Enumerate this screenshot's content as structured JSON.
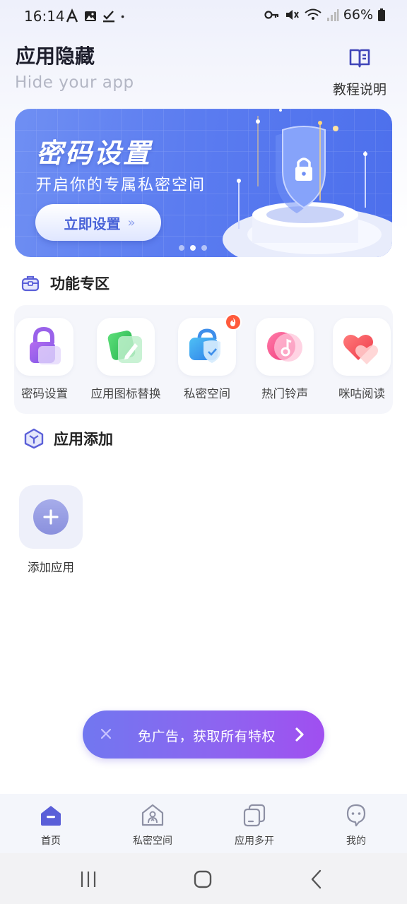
{
  "status_bar": {
    "time": "16:14",
    "battery": "66%"
  },
  "header": {
    "title": "应用隐藏",
    "subtitle": "Hide your app",
    "tutorial_label": "教程说明"
  },
  "banner": {
    "title": "密码设置",
    "subtitle": "开启你的专属私密空间",
    "button_label": "立即设置",
    "button_arrow": "»",
    "active_page": 1,
    "page_count": 3
  },
  "features_section": {
    "title": "功能专区",
    "items": [
      {
        "label": "密码设置",
        "icon": "lock-icon"
      },
      {
        "label": "应用图标替换",
        "icon": "edit-icon"
      },
      {
        "label": "私密空间",
        "icon": "shield-bag-icon",
        "badge": "hot"
      },
      {
        "label": "热门铃声",
        "icon": "music-note-icon"
      },
      {
        "label": "咪咕阅读",
        "icon": "heart-icon"
      }
    ]
  },
  "add_section": {
    "title": "应用添加",
    "add_label": "添加应用"
  },
  "promo": {
    "text": "免广告，获取所有特权"
  },
  "bottom_nav": {
    "items": [
      {
        "label": "首页",
        "icon": "home-icon",
        "active": true
      },
      {
        "label": "私密空间",
        "icon": "private-space-icon",
        "active": false
      },
      {
        "label": "应用多开",
        "icon": "multi-app-icon",
        "active": false
      },
      {
        "label": "我的",
        "icon": "profile-icon",
        "active": false
      }
    ]
  },
  "colors": {
    "accent": "#5a5fd8",
    "banner": "#5b7cf0",
    "promo_start": "#7177f0",
    "promo_end": "#a04ff0"
  }
}
